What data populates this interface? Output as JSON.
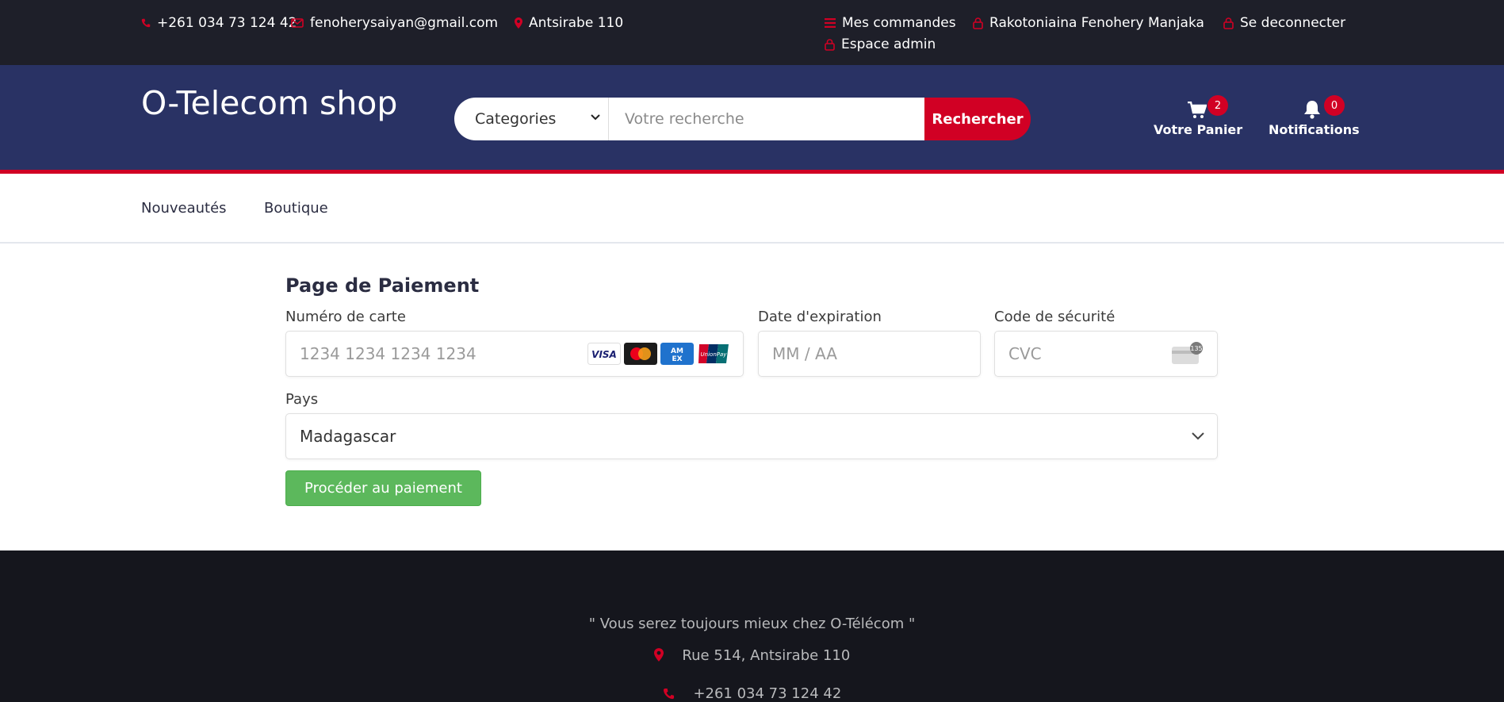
{
  "topbar": {
    "phone": "+261 034 73 124 42",
    "email": "fenoherysaiyan@gmail.com",
    "location": "Antsirabe 110",
    "orders": "Mes commandes",
    "user": "Rakotoniaina Fenohery Manjaka",
    "logout": "Se deconnecter",
    "admin": "Espace admin"
  },
  "header": {
    "logo": "O-Telecom shop",
    "categories": "Categories",
    "search_placeholder": "Votre recherche",
    "search_button": "Rechercher",
    "cart_label": "Votre Panier",
    "cart_count": "2",
    "notif_label": "Notifications",
    "notif_count": "0"
  },
  "nav": {
    "item1": "Nouveautés",
    "item2": "Boutique"
  },
  "payment": {
    "title": "Page de Paiement",
    "card_label": "Numéro de carte",
    "card_placeholder": "1234 1234 1234 1234",
    "exp_label": "Date d'expiration",
    "exp_placeholder": "MM / AA",
    "cvc_label": "Code de sécurité",
    "cvc_placeholder": "CVC",
    "cvc_icon_text": "135",
    "country_label": "Pays",
    "country_value": "Madagascar",
    "submit": "Procéder au paiement",
    "card_brands": [
      "VISA",
      "Mastercard",
      "AMEX",
      "UnionPay"
    ]
  },
  "footer": {
    "slogan": "\" Vous serez toujours mieux chez O-Télécom \"",
    "address": "Rue 514, Antsirabe 110",
    "phone": "+261 034 73 124 42"
  },
  "colors": {
    "accent": "#d10024",
    "header_bg": "#293264",
    "topbar_bg": "#1e1f29",
    "footer_bg": "#15161d",
    "pay_button": "#5cb85c"
  }
}
